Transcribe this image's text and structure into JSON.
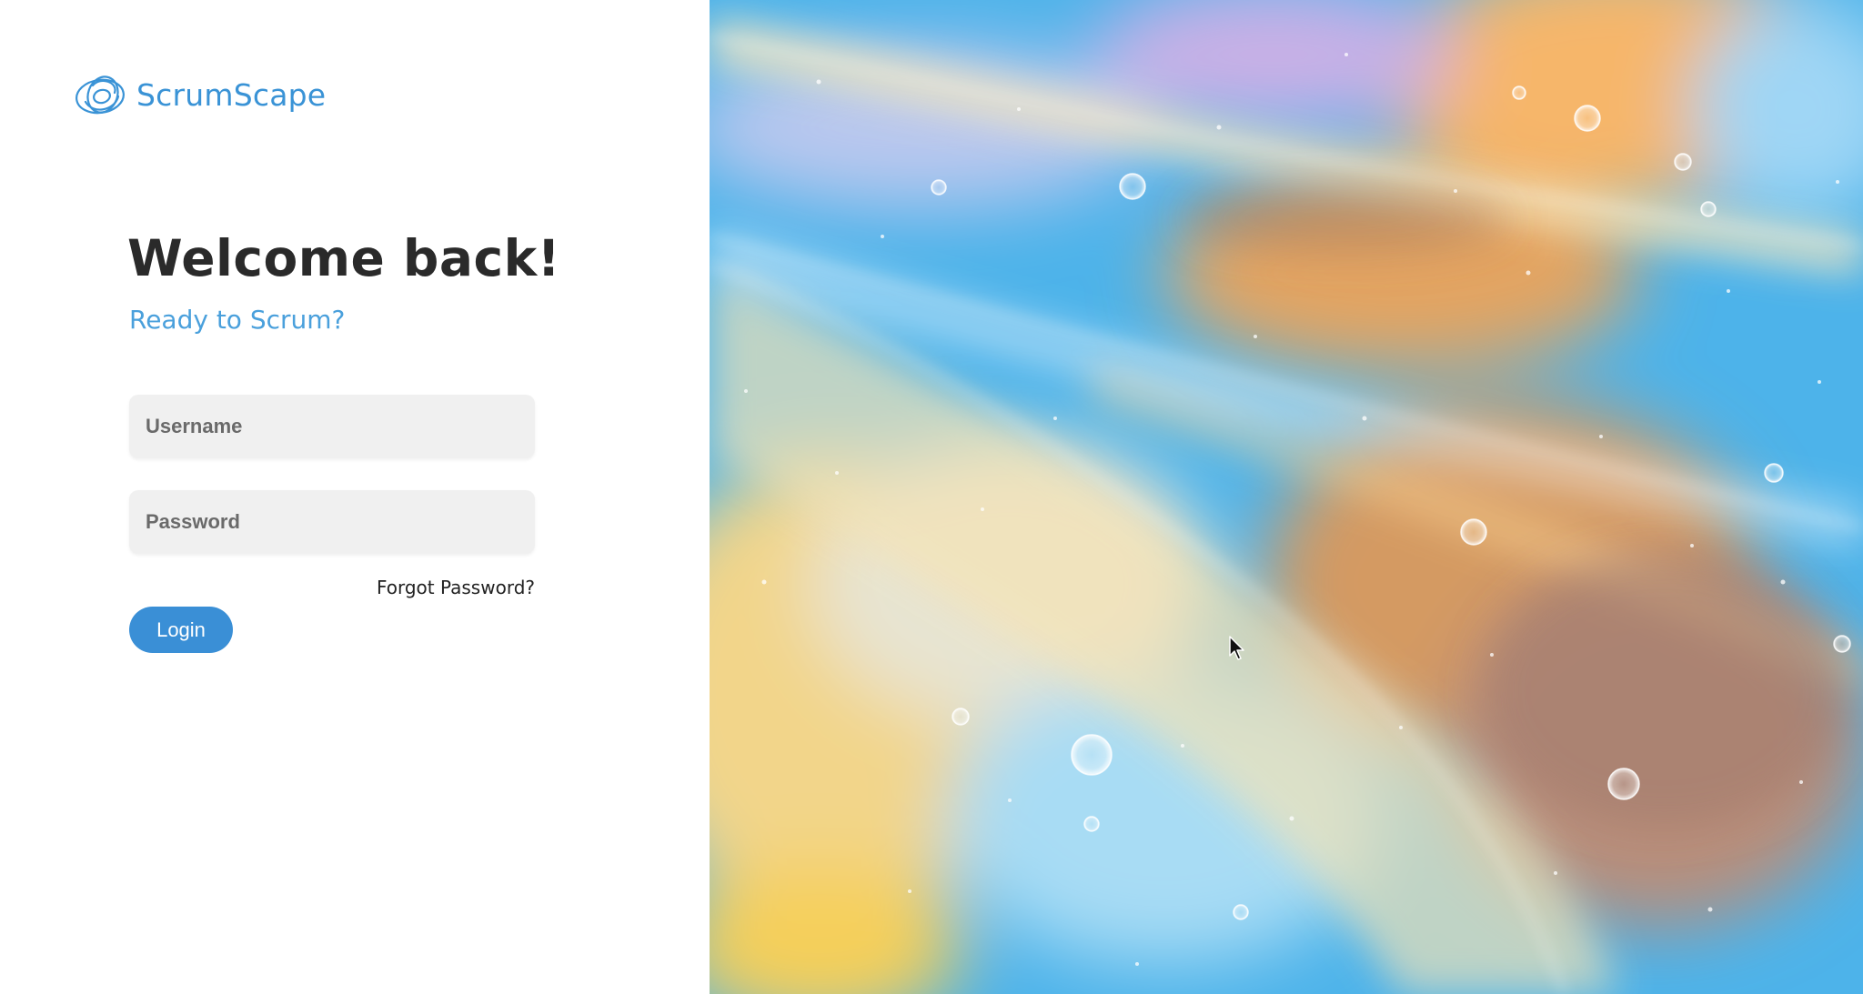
{
  "logo": {
    "text": "ScrumScape",
    "icon": "swirl-logo-icon"
  },
  "login": {
    "title": "Welcome back!",
    "subtitle": "Ready to Scrum?",
    "username_placeholder": "Username",
    "password_placeholder": "Password",
    "forgot_label": "Forgot Password?",
    "login_label": "Login"
  },
  "colors": {
    "accent": "#3a8fd6",
    "subtitle": "#4aa0dc",
    "title": "#2a2a2a",
    "input_bg": "#f0f0f0"
  },
  "background_image": {
    "icon": "abstract-oil-bubbles-image"
  }
}
